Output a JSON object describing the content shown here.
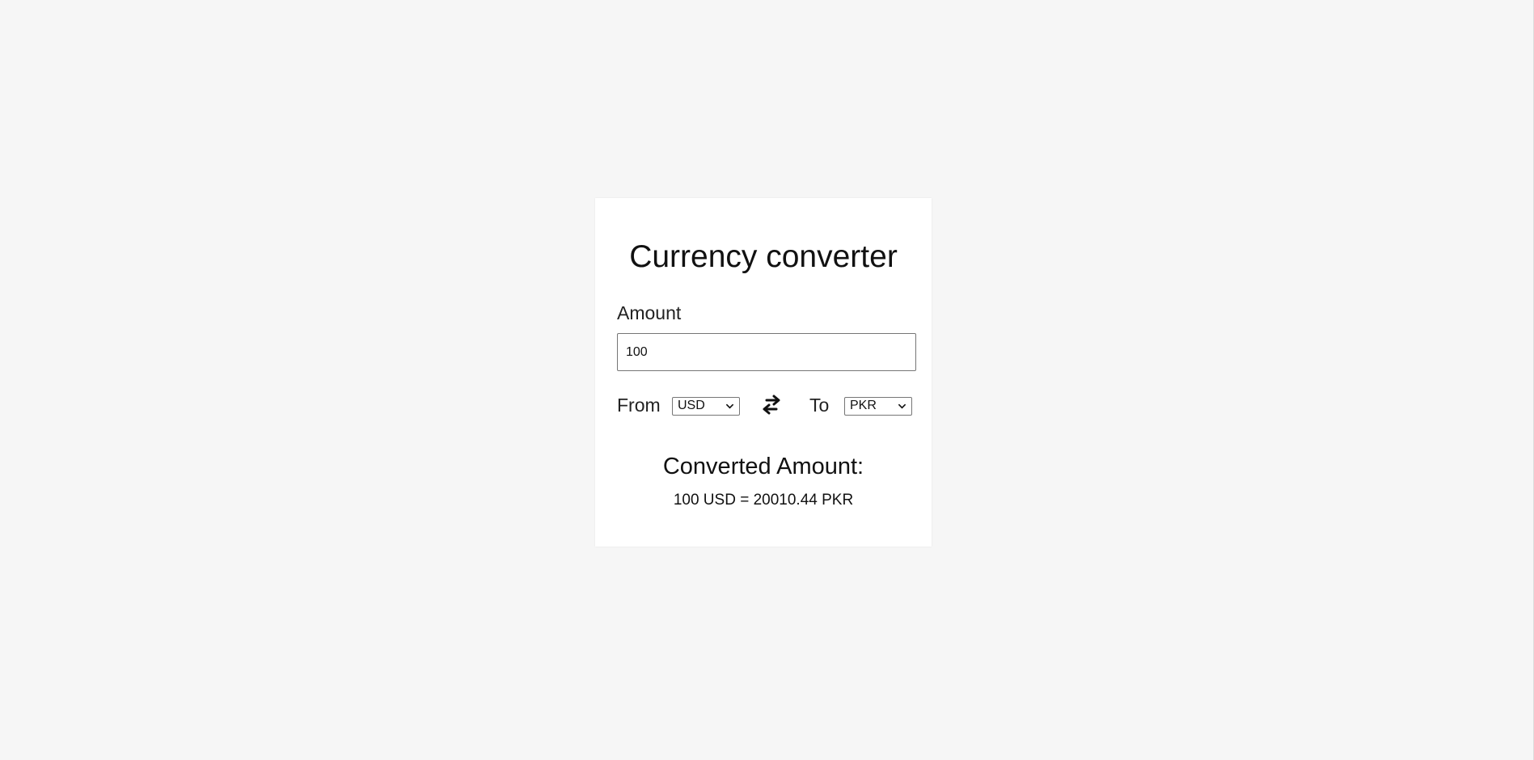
{
  "app": {
    "title": "Currency converter"
  },
  "amount": {
    "label": "Amount",
    "value": "100"
  },
  "conversion": {
    "from_label": "From",
    "from_currency": "USD",
    "to_label": "To",
    "to_currency": "PKR"
  },
  "result": {
    "heading": "Converted Amount:",
    "text": "100 USD = 20010.44 PKR"
  },
  "icons": {
    "swap": "swap-arrows-icon",
    "dropdown": "chevron-down-icon"
  },
  "colors": {
    "page_background": "#f6f6f6",
    "card_background": "#ffffff",
    "text": "#111111"
  }
}
